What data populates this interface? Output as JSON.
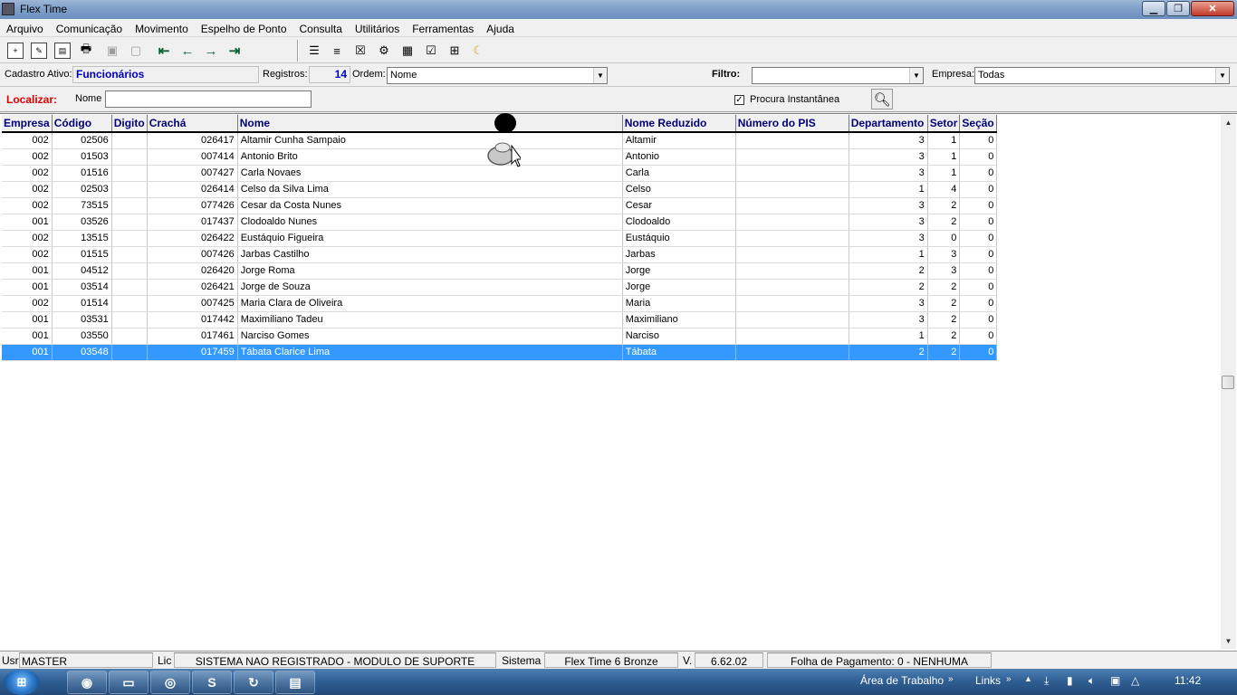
{
  "window": {
    "title": "Flex Time",
    "min_label": "▁",
    "max_label": "❐",
    "close_label": "✕"
  },
  "menu": [
    "Arquivo",
    "Comunicação",
    "Movimento",
    "Espelho de Ponto",
    "Consulta",
    "Utilitários",
    "Ferramentas",
    "Ajuda"
  ],
  "info": {
    "cadastro_label": "Cadastro Ativo:",
    "cadastro_value": "Funcionários",
    "registros_label": "Registros:",
    "registros_value": "14",
    "ordem_label": "Ordem:",
    "ordem_value": "Nome",
    "filtro_label": "Filtro:",
    "filtro_value": "",
    "empresa_label": "Empresa:",
    "empresa_value": "Todas"
  },
  "locate": {
    "localizar_label": "Localizar:",
    "nome_label": "Nome",
    "nome_value": "",
    "instant_label": "Procura Instantânea",
    "instant_checked": true
  },
  "grid": {
    "columns": [
      "Empresa",
      "Código",
      "Digito",
      "Crachá",
      "Nome",
      "Nome Reduzido",
      "Número do PIS",
      "Departamento",
      "Setor",
      "Seção"
    ],
    "rows": [
      [
        "002",
        "02506",
        "",
        "026417",
        "Altamir Cunha Sampaio",
        "Altamir",
        "",
        "3",
        "1",
        "0"
      ],
      [
        "002",
        "01503",
        "",
        "007414",
        "Antonio Brito",
        "Antonio",
        "",
        "3",
        "1",
        "0"
      ],
      [
        "002",
        "01516",
        "",
        "007427",
        "Carla Novaes",
        "Carla",
        "",
        "3",
        "1",
        "0"
      ],
      [
        "002",
        "02503",
        "",
        "026414",
        "Celso da Silva Lima",
        "Celso",
        "",
        "1",
        "4",
        "0"
      ],
      [
        "002",
        "73515",
        "",
        "077426",
        "Cesar da Costa Nunes",
        "Cesar",
        "",
        "3",
        "2",
        "0"
      ],
      [
        "001",
        "03526",
        "",
        "017437",
        "Clodoaldo Nunes",
        "Clodoaldo",
        "",
        "3",
        "2",
        "0"
      ],
      [
        "002",
        "13515",
        "",
        "026422",
        "Eustáquio Figueira",
        "Eustáquio",
        "",
        "3",
        "0",
        "0"
      ],
      [
        "002",
        "01515",
        "",
        "007426",
        "Jarbas Castilho",
        "Jarbas",
        "",
        "1",
        "3",
        "0"
      ],
      [
        "001",
        "04512",
        "",
        "026420",
        "Jorge Roma",
        "Jorge",
        "",
        "2",
        "3",
        "0"
      ],
      [
        "001",
        "03514",
        "",
        "026421",
        "Jorge de Souza",
        "Jorge",
        "",
        "2",
        "2",
        "0"
      ],
      [
        "002",
        "01514",
        "",
        "007425",
        "Maria Clara de Oliveira",
        "Maria",
        "",
        "3",
        "2",
        "0"
      ],
      [
        "001",
        "03531",
        "",
        "017442",
        "Maximiliano Tadeu",
        "Maximiliano",
        "",
        "3",
        "2",
        "0"
      ],
      [
        "001",
        "03550",
        "",
        "017461",
        "Narciso Gomes",
        "Narciso",
        "",
        "1",
        "2",
        "0"
      ],
      [
        "001",
        "03548",
        "",
        "017459",
        "Tábata Clarice Lima",
        "Tábata",
        "",
        "2",
        "2",
        "0"
      ]
    ],
    "selected_row": 13
  },
  "status": {
    "usr_label": "Usr",
    "usr_value": "MASTER",
    "lic_label": "Lic",
    "lic_value": "SISTEMA NAO REGISTRADO - MODULO DE SUPORTE",
    "sistema_label": "Sistema",
    "sistema_value": "Flex Time 6 Bronze",
    "v_label": "V.",
    "v_value": "6.62.02",
    "folha": "Folha de Pagamento: 0 - NENHUMA"
  },
  "taskbar": {
    "area_label": "Área de Trabalho",
    "links_label": "Links",
    "clock": "11:42",
    "apps": [
      "chrome-icon",
      "folder-icon",
      "browser-icon",
      "skype-icon",
      "sync-icon",
      "flextime-icon"
    ]
  },
  "colors": {
    "header_text": "#00007a",
    "selected_row": "#3399ff",
    "localizar": "#e00000",
    "cadastro_value": "#0000c0"
  }
}
